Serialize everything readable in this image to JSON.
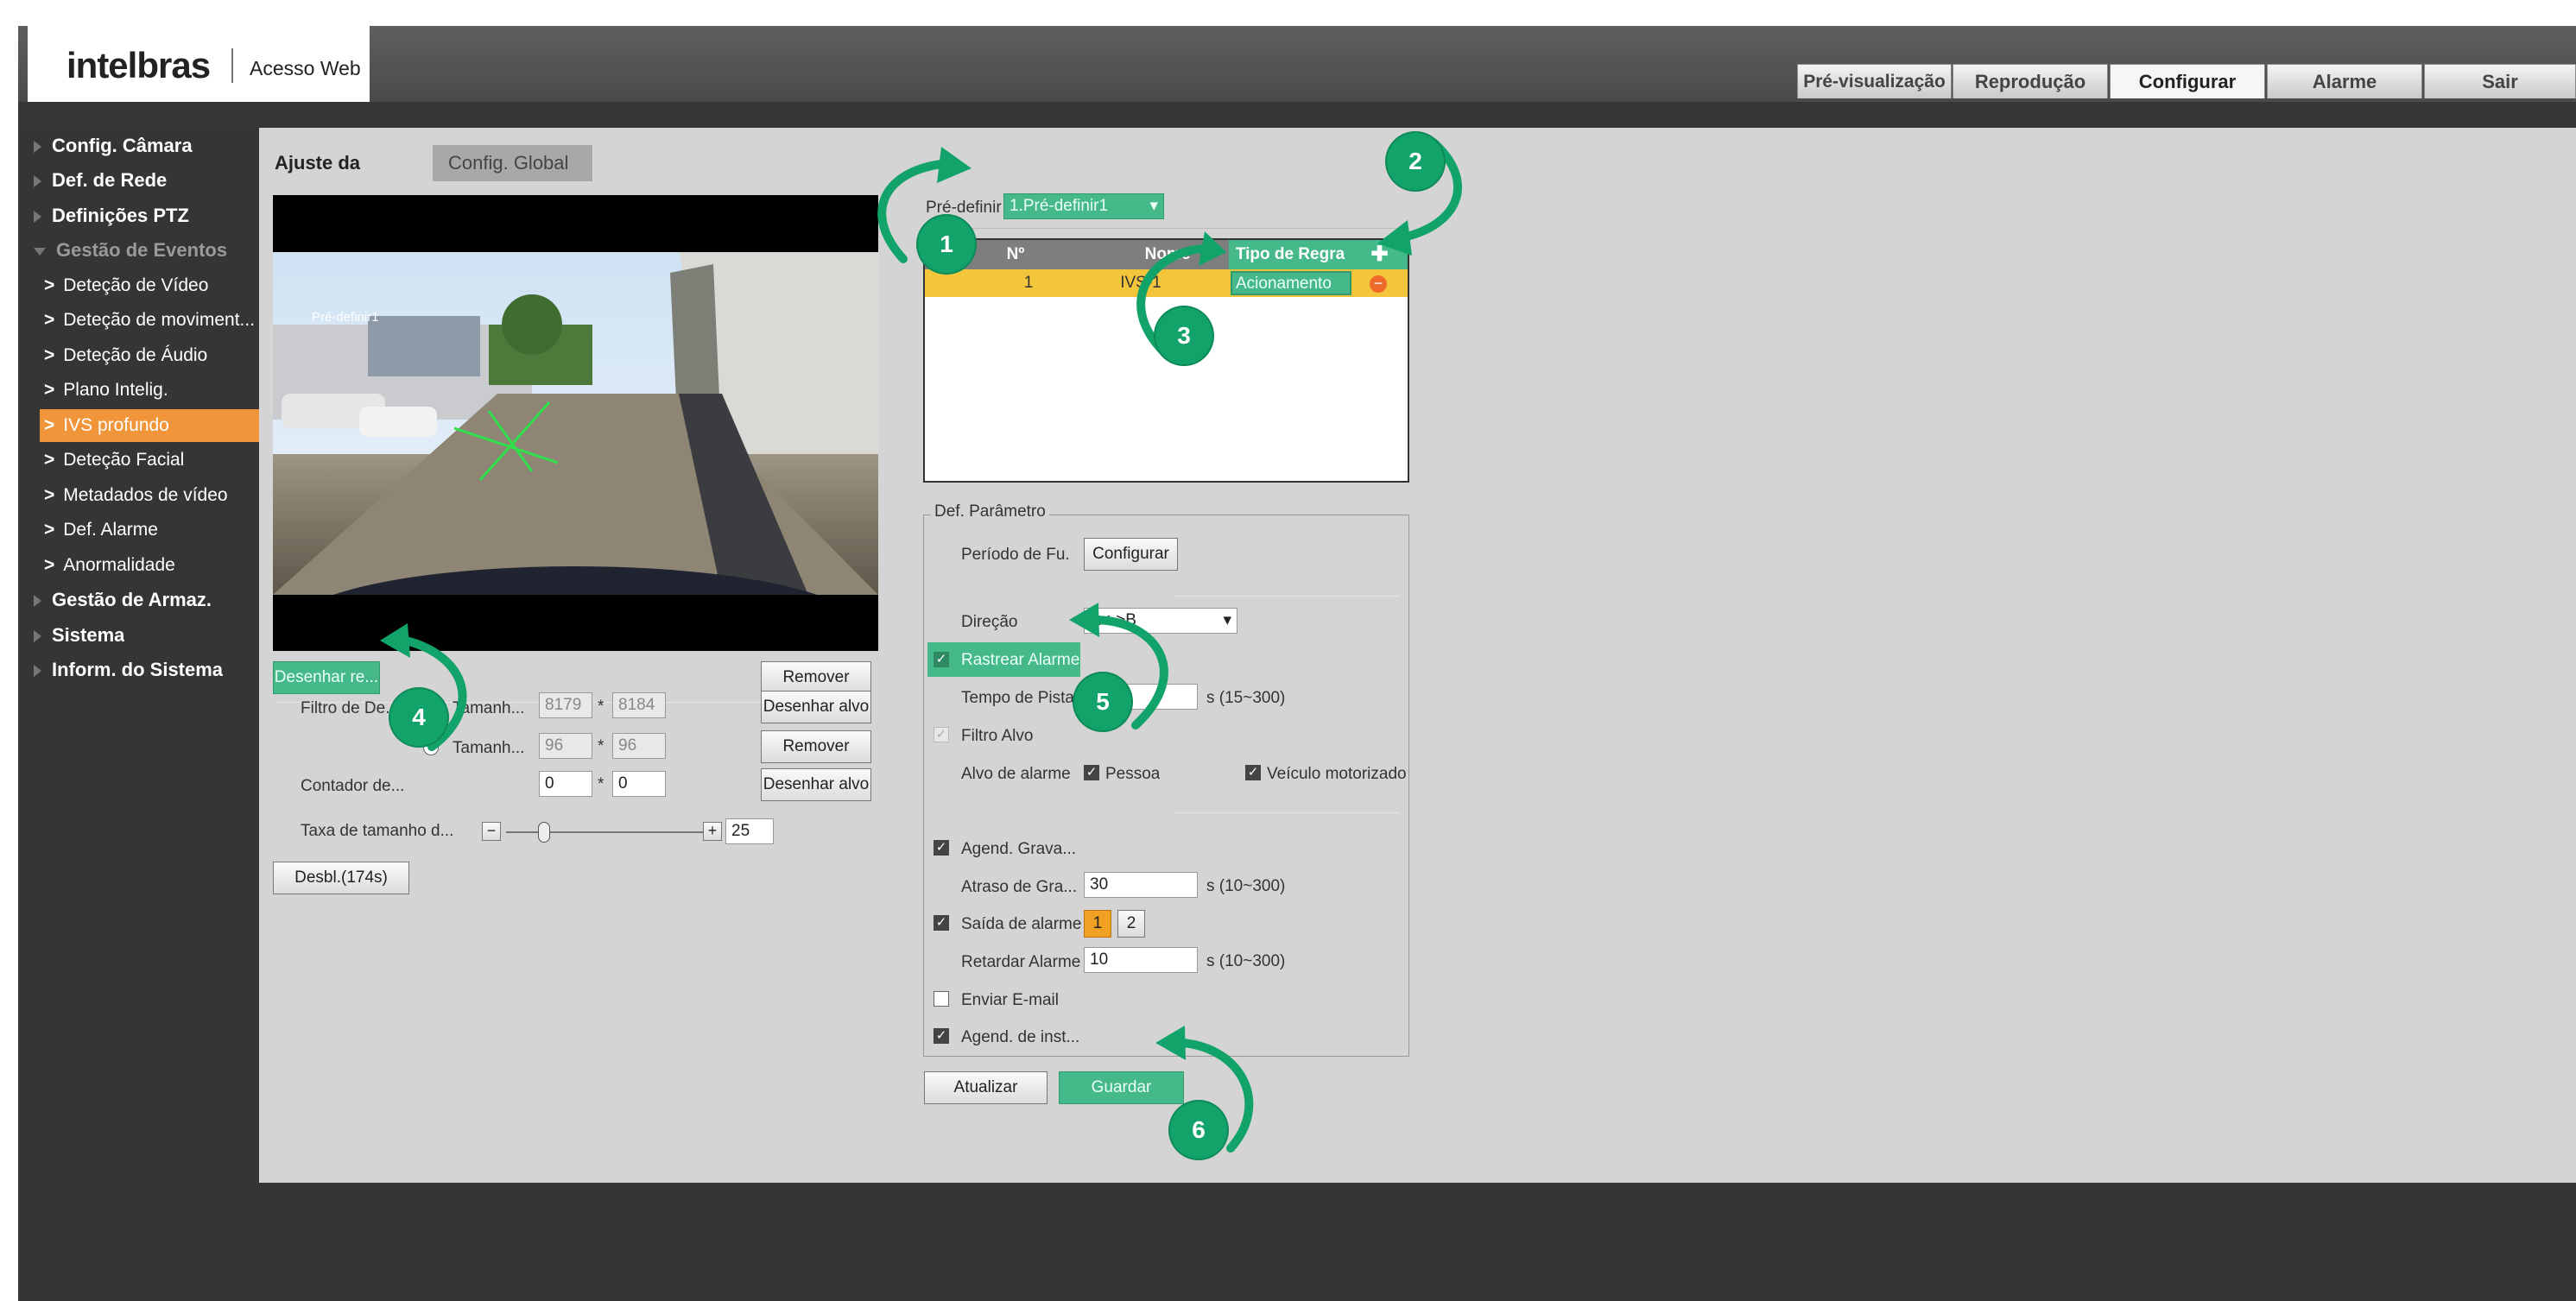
{
  "header": {
    "brand": "intelbras",
    "subtitle": "Acesso Web",
    "nav": [
      "Pré-visualização",
      "Reprodução",
      "Configurar",
      "Alarme",
      "Sair"
    ]
  },
  "sidebar": {
    "items": [
      {
        "label": "Config. Câmara"
      },
      {
        "label": "Def. de Rede"
      },
      {
        "label": "Definições PTZ"
      },
      {
        "label": "Gestão de Eventos"
      },
      {
        "label": "Deteção de Vídeo"
      },
      {
        "label": "Deteção de moviment..."
      },
      {
        "label": "Deteção de Áudio"
      },
      {
        "label": "Plano Intelig."
      },
      {
        "label": "IVS profundo"
      },
      {
        "label": "Deteção Facial"
      },
      {
        "label": "Metadados de vídeo"
      },
      {
        "label": "Def. Alarme"
      },
      {
        "label": "Anormalidade"
      },
      {
        "label": "Gestão de Armaz."
      },
      {
        "label": "Sistema"
      },
      {
        "label": "Inform. do Sistema"
      }
    ]
  },
  "tabs": [
    "Ajuste da regra",
    "Config. Global"
  ],
  "video": {
    "overlay_label": "Pré-definir1"
  },
  "left_panel": {
    "draw_rule_button": "Desenhar re...",
    "remove_button": "Remover",
    "object_filter_label": "Filtro de De...",
    "size_label_1": "Tamanh...",
    "max_w": "8179",
    "max_h": "8184",
    "times": "*",
    "draw_target_button": "Desenhar alvo",
    "size_label_2": "Tamanh...",
    "min_w": "96",
    "min_h": "96",
    "remove_button_2": "Remover",
    "counter_label": "Contador de...",
    "counter_a": "0",
    "counter_b": "0",
    "draw_target_button_2": "Desenhar alvo",
    "size_rate_label": "Taxa de tamanho d...",
    "size_rate_value": "25",
    "unlock_button": "Desbl.(174s)"
  },
  "rule_panel": {
    "preset_label": "Pré-definir",
    "preset_value": "1.Pré-definir1",
    "columns": [
      "Nº",
      "Nome",
      "Tipo de Regra"
    ],
    "rows": [
      {
        "no": "1",
        "name": "IVS-1",
        "type": "Acionamento"
      }
    ]
  },
  "params": {
    "legend": "Def. Parâmetro",
    "schedule_label": "Período de Fu...",
    "configure_button": "Configurar",
    "direction_label": "Direção",
    "direction_value": "A<->B",
    "track_alarm_label": "Rastrear Alarme",
    "track_time_label": "Tempo de Pista",
    "track_time_value": "15",
    "track_time_unit": "s (15~300)",
    "target_filter_label": "Filtro Alvo",
    "alarm_target_label": "Alvo de alarme",
    "person_label": "Pessoa",
    "vehicle_label": "Veículo motorizado",
    "record_label": "Agend. Grava...",
    "record_delay_label": "Atraso de Gra...",
    "record_delay_value": "30",
    "record_delay_unit": "s (10~300)",
    "alarm_out_label": "Saída de alarme",
    "alarm_out_1": "1",
    "alarm_out_2": "2",
    "alarm_delay_label": "Retardar Alarme",
    "alarm_delay_value": "10",
    "alarm_delay_unit": "s (10~300)",
    "email_label": "Enviar E-mail",
    "snapshot_label": "Agend. de inst..."
  },
  "actions": {
    "refresh": "Atualizar",
    "save": "Guardar"
  },
  "callouts": [
    "1",
    "2",
    "3",
    "4",
    "5",
    "6"
  ],
  "colors": {
    "accent_orange": "#f0953a",
    "callout_green": "#12a36a",
    "highlight_green": "#46b98a",
    "row_yellow": "#f3c53a"
  }
}
